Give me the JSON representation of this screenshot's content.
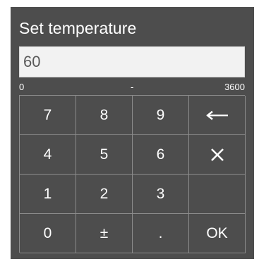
{
  "dialog": {
    "title": "Set temperature",
    "value": "60",
    "range": {
      "min": "0",
      "separator": "-",
      "max": "3600"
    }
  },
  "keypad": {
    "keys": {
      "k7": "7",
      "k8": "8",
      "k9": "9",
      "k4": "4",
      "k5": "5",
      "k6": "6",
      "k1": "1",
      "k2": "2",
      "k3": "3",
      "k0": "0",
      "plusminus": "±",
      "dot": ".",
      "ok": "OK"
    },
    "icons": {
      "backspace": "left-arrow-icon",
      "clear": "close-x-icon"
    }
  },
  "colors": {
    "panel": "#4d4d4d",
    "grid_lines": "#8c8c8c",
    "text": "#ffffff",
    "input_bg": "#f2f2f2"
  }
}
